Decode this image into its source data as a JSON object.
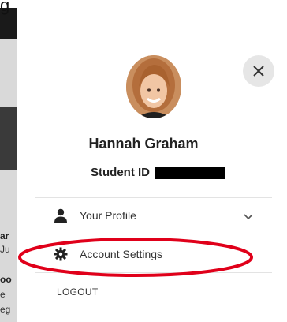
{
  "background": {
    "top_glyph": "g",
    "fragments": [
      "ar",
      "Ju",
      "oo",
      "e",
      "eg"
    ]
  },
  "profile": {
    "name": "Hannah Graham",
    "student_id_label": "Student ID"
  },
  "menu": {
    "items": [
      {
        "label": "Your Profile",
        "icon": "person-icon",
        "expandable": true
      },
      {
        "label": "Account Settings",
        "icon": "gear-icon",
        "expandable": false
      }
    ],
    "logout_label": "LOGOUT"
  },
  "colors": {
    "annotation_red": "#e0001a",
    "close_button_bg": "#e6e6e6",
    "redaction": "#000000"
  }
}
